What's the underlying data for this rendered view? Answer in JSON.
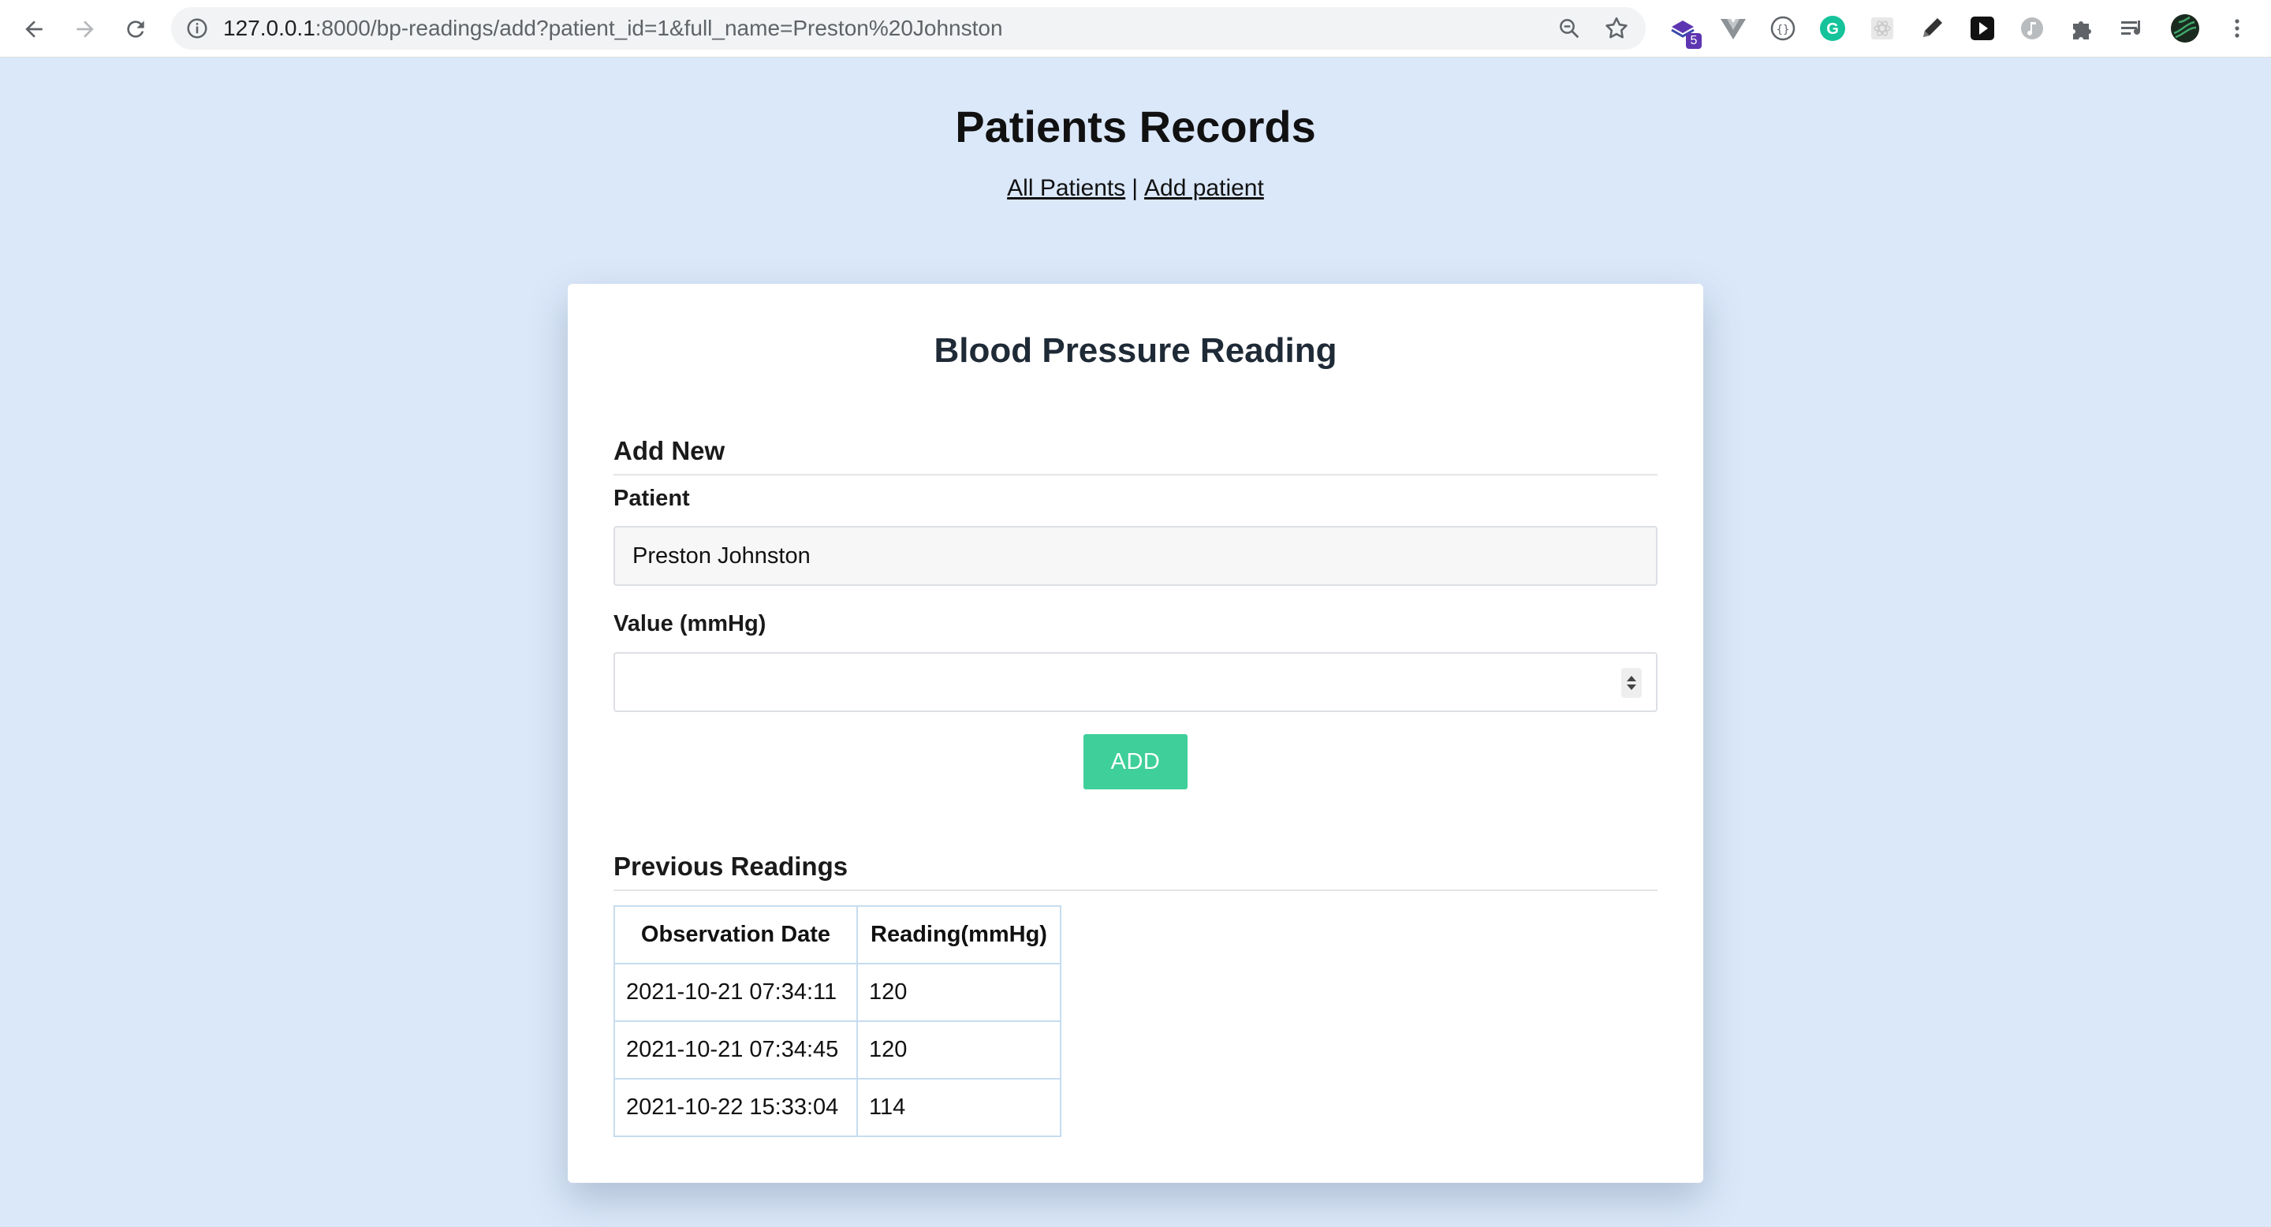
{
  "browser": {
    "url_host": "127.0.0.1",
    "url_rest": ":8000/bp-readings/add?patient_id=1&full_name=Preston%20Johnston",
    "extensions": [
      {
        "icon": "puzzle-stack-extension-icon",
        "badge": "5"
      },
      {
        "icon": "vue-devtools-icon"
      },
      {
        "icon": "json-viewer-icon"
      },
      {
        "icon": "grammarly-icon"
      },
      {
        "icon": "react-devtools-icon"
      },
      {
        "icon": "pencil-icon"
      },
      {
        "icon": "play-icon"
      },
      {
        "icon": "music-icon"
      },
      {
        "icon": "extensions-puzzle-icon"
      },
      {
        "icon": "reading-list-icon"
      },
      {
        "icon": "profile-avatar-icon"
      },
      {
        "icon": "more-menu-icon"
      }
    ]
  },
  "site": {
    "title": "Patients Records",
    "nav": {
      "all_patients": "All Patients",
      "separator": "|",
      "add_patient": "Add patient"
    }
  },
  "card": {
    "title": "Blood Pressure Reading",
    "form": {
      "section_title": "Add New",
      "patient_label": "Patient",
      "patient_value": "Preston Johnston",
      "value_label": "Value (mmHg)",
      "value_value": "",
      "submit_label": "ADD"
    },
    "history": {
      "section_title": "Previous Readings",
      "columns": [
        "Observation Date",
        "Reading(mmHg)"
      ],
      "rows": [
        [
          "2021-10-21 07:34:11",
          "120"
        ],
        [
          "2021-10-21 07:34:45",
          "120"
        ],
        [
          "2021-10-22 15:33:04",
          "114"
        ]
      ]
    }
  },
  "colors": {
    "page_background": "#dbe8fa",
    "add_button": "#3ecf9a",
    "table_border": "#c6dcf0"
  }
}
